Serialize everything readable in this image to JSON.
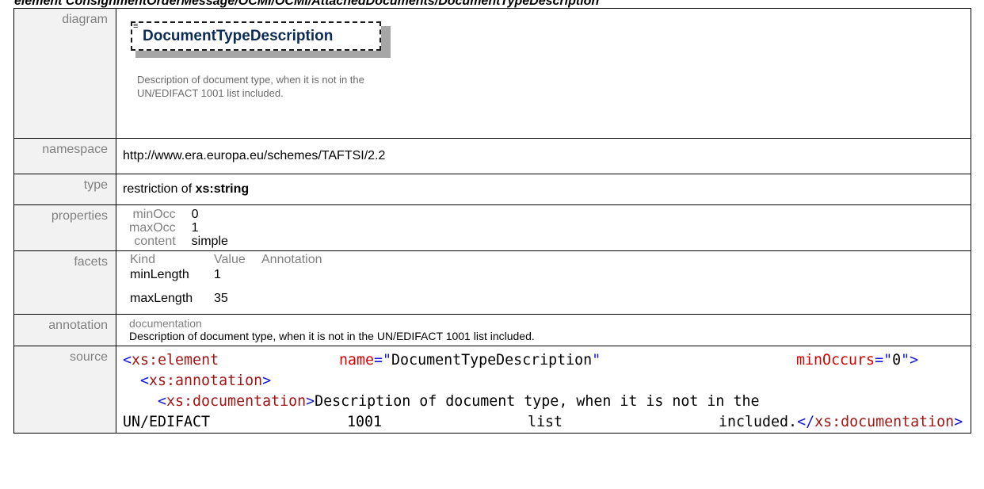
{
  "page_heading": "element ConsignmentOrderMessage/OCMI/OCMI/AttachedDocuments/DocumentTypeDescription",
  "rows": {
    "diagram": {
      "label": "diagram",
      "element_name": "DocumentTypeDescription",
      "description": "Description of document type, when it is not in the UN/EDIFACT 1001 list included.",
      "annotation_icon": "annotation-lines-icon"
    },
    "namespace": {
      "label": "namespace",
      "value": "http://www.era.europa.eu/schemes/TAFTSI/2.2"
    },
    "type": {
      "label": "type",
      "prefix": "restriction of",
      "base": "xs:string"
    },
    "properties": {
      "label": "properties",
      "items": [
        {
          "key": "minOcc",
          "value": "0"
        },
        {
          "key": "maxOcc",
          "value": "1"
        },
        {
          "key": "content",
          "value": "simple"
        }
      ]
    },
    "facets": {
      "label": "facets",
      "headers": [
        "Kind",
        "Value",
        "Annotation"
      ],
      "items": [
        {
          "kind": "minLength",
          "value": "1",
          "annotation": ""
        },
        {
          "kind": "maxLength",
          "value": "35",
          "annotation": ""
        }
      ]
    },
    "annotation": {
      "label": "annotation",
      "key": "documentation",
      "value": "Description of document type, when it is not in the UN/EDIFACT 1001 list included."
    },
    "source": {
      "label": "source",
      "line1": {
        "open": "<",
        "tag": "xs:element",
        "attr1": "name",
        "eq1": "=\"",
        "val1": "DocumentTypeDescription",
        "close1": "\"",
        "attr2": "minOccurs",
        "eq2": "=\"",
        "val2": "0",
        "close2": "\">"
      },
      "line2": {
        "open": "<",
        "tag": "xs:annotation",
        "close": ">"
      },
      "line3": {
        "open": "<",
        "tag": "xs:documentation",
        "close": ">",
        "text": "Description of document type, when it is not in the"
      },
      "line4": {
        "w1": "UN/EDIFACT",
        "w2": "1001",
        "w3": "list",
        "w4": "included.",
        "end_open": "</",
        "end_tag": "xs:documentation",
        "end_close": ">"
      }
    }
  }
}
